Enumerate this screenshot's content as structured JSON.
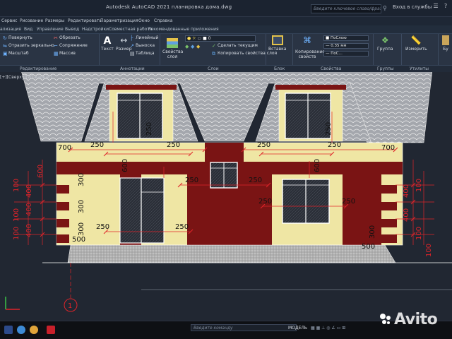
{
  "window": {
    "title": "Autodesk AutoCAD 2021   планировка дома.dwg",
    "search_placeholder": "Введите ключевое слово/фразу",
    "signin_label": "Вход в службы"
  },
  "menu": [
    "Сервис",
    "Рисование",
    "Размеры",
    "Редактировать",
    "Параметризация",
    "Окно",
    "Справка"
  ],
  "ribbon_tabs": [
    "ализация",
    "Вид",
    "Управление",
    "Вывод",
    "Надстройки",
    "Совместная работа",
    "Рекомендованные приложения"
  ],
  "ribbon": {
    "modify_tools": [
      "Повернуть",
      "Отразить зеркально",
      "Масштаб",
      "Обрезать",
      "Сопряжение",
      "Массив"
    ],
    "text_tool": "Текст",
    "dimension_tool": "Размер",
    "annotation_tools": [
      "Линейный",
      "Выноска",
      "Таблица"
    ],
    "layer_properties": "Свойства слоя",
    "layer_value": "0",
    "layer_tools": [
      "Сделать текущим",
      "Копировать свойства слоя"
    ],
    "insert_tool": "Вставка",
    "copy_props": "Копирование свойств",
    "prop_values": [
      "ПоСлою",
      "0.35 мм",
      "ПоС..."
    ],
    "group_tool": "Группа",
    "measure_tool": "Измерить",
    "clipboard_tool": "Бу"
  },
  "panel_titles": [
    "Редактирование",
    "Аннотации",
    "Слои",
    "Блок",
    "Свойства",
    "Группы",
    "Утилиты"
  ],
  "viewport": {
    "label": "[+][Сверху][2D-каркас]"
  },
  "drawing": {
    "dims": {
      "d700": "700",
      "d250": "250",
      "d600": "600",
      "d300": "300",
      "d100": "100",
      "d400": "400",
      "d500": "500"
    },
    "axis_label": "1"
  },
  "status": {
    "command_placeholder": "Введите команду",
    "model_label": "МОДЕЛЬ"
  },
  "watermark": "Avito",
  "colors": {
    "wall_yellow": "#efe6a4",
    "timber_maroon": "#7a1414",
    "dimension_red": "#e0242a",
    "roof_gray": "#a8aab0",
    "viewport_bg": "#212732"
  }
}
